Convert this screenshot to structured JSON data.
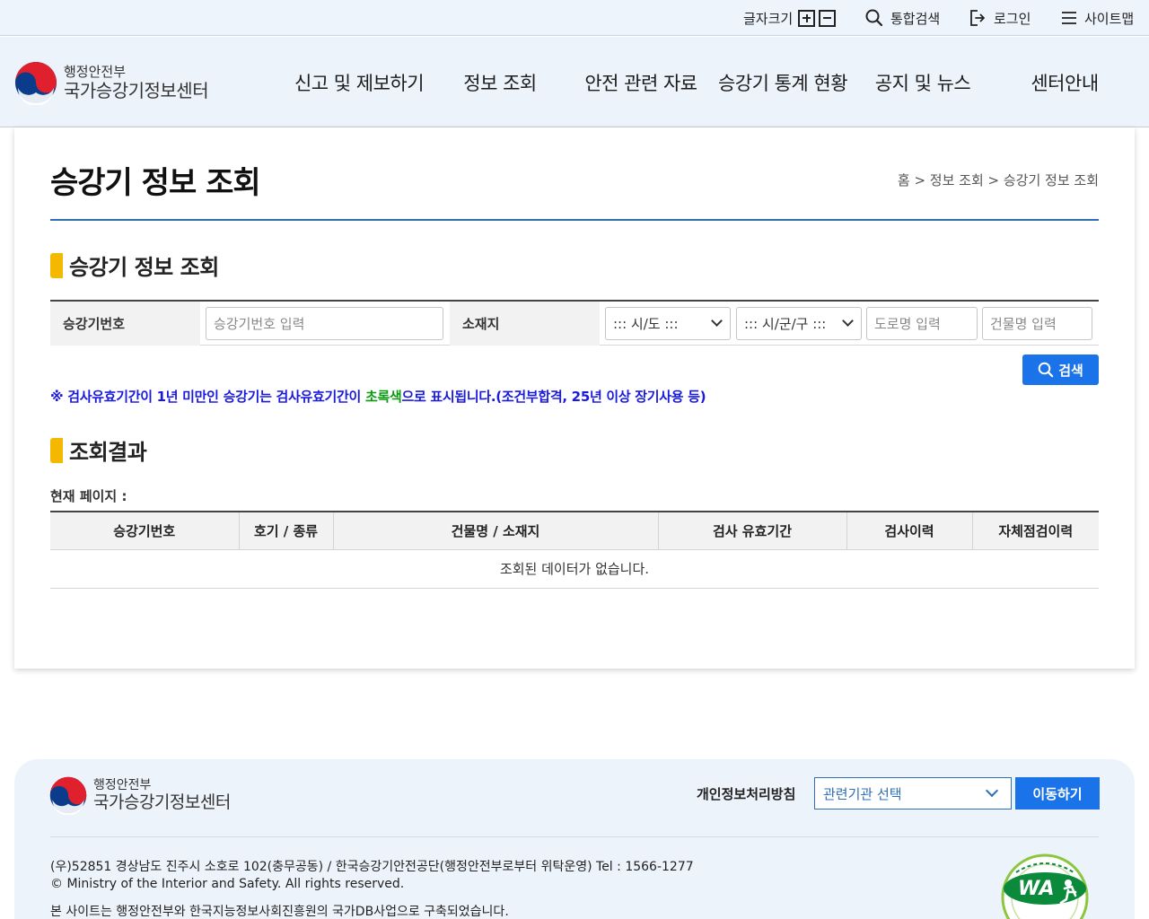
{
  "utility_bar": {
    "font_size_label": "글자크기",
    "unified_search": "통합검색",
    "login": "로그인",
    "sitemap": "사이트맵"
  },
  "logo": {
    "ministry": "행정안전부",
    "center": "국가승강기정보센터"
  },
  "nav": {
    "items": [
      "신고 및 제보하기",
      "정보 조회",
      "안전 관련 자료",
      "승강기 통계 현황",
      "공지 및 뉴스",
      "센터안내"
    ]
  },
  "page": {
    "title": "승강기 정보 조회",
    "breadcrumb": "홈 > 정보 조회 > 승강기 정보 조회"
  },
  "search": {
    "section_title": "승강기 정보 조회",
    "elevator_no_label": "승강기번호",
    "elevator_no_placeholder": "승강기번호 입력",
    "location_label": "소재지",
    "sido_selected": "::: 시/도 :::",
    "sigungu_selected": "::: 시/군/구 :::",
    "road_placeholder": "도로명 입력",
    "building_placeholder": "건물명 입력",
    "search_button": "검색",
    "notice_prefix": "※ 검사유효기간이 1년 미만인 승강기는 검사유효기간이 ",
    "notice_green": "초록색",
    "notice_suffix": "으로 표시됩니다.(조건부합격, 25년 이상 장기사용 등)",
    "notice_color": "#1a1adf",
    "highlight_color": "#0a9a10"
  },
  "results": {
    "section_title": "조회결과",
    "current_page_label": "현재 페이지 :",
    "columns": [
      "승강기번호",
      "호기 / 종류",
      "건물명 / 소재지",
      "검사 유효기간",
      "검사이력",
      "자체점검이력"
    ],
    "empty_message": "조회된 데이터가 없습니다."
  },
  "footer": {
    "ministry": "행정안전부",
    "center": "국가승강기정보센터",
    "privacy_policy": "개인정보처리방침",
    "org_select": "관련기관 선택",
    "go_button": "이동하기",
    "address": "(우)52851 경상남도 진주시 소호로 102(충무공동) / 한국승강기안전공단(행정안전부로부터 위탁운영) Tel : 1566-1277",
    "copyright": "© Ministry of the Interior and Safety. All rights reserved.",
    "db_notice": "본 사이트는 행정안전부와 한국지능정보사회진흥원의 국가DB사업으로 구축되었습니다."
  },
  "colors": {
    "accent": "#1a73e8",
    "title_rule": "#2f6fb5",
    "section_marker": "#f5b800",
    "header_bg": "#edf3fb"
  }
}
